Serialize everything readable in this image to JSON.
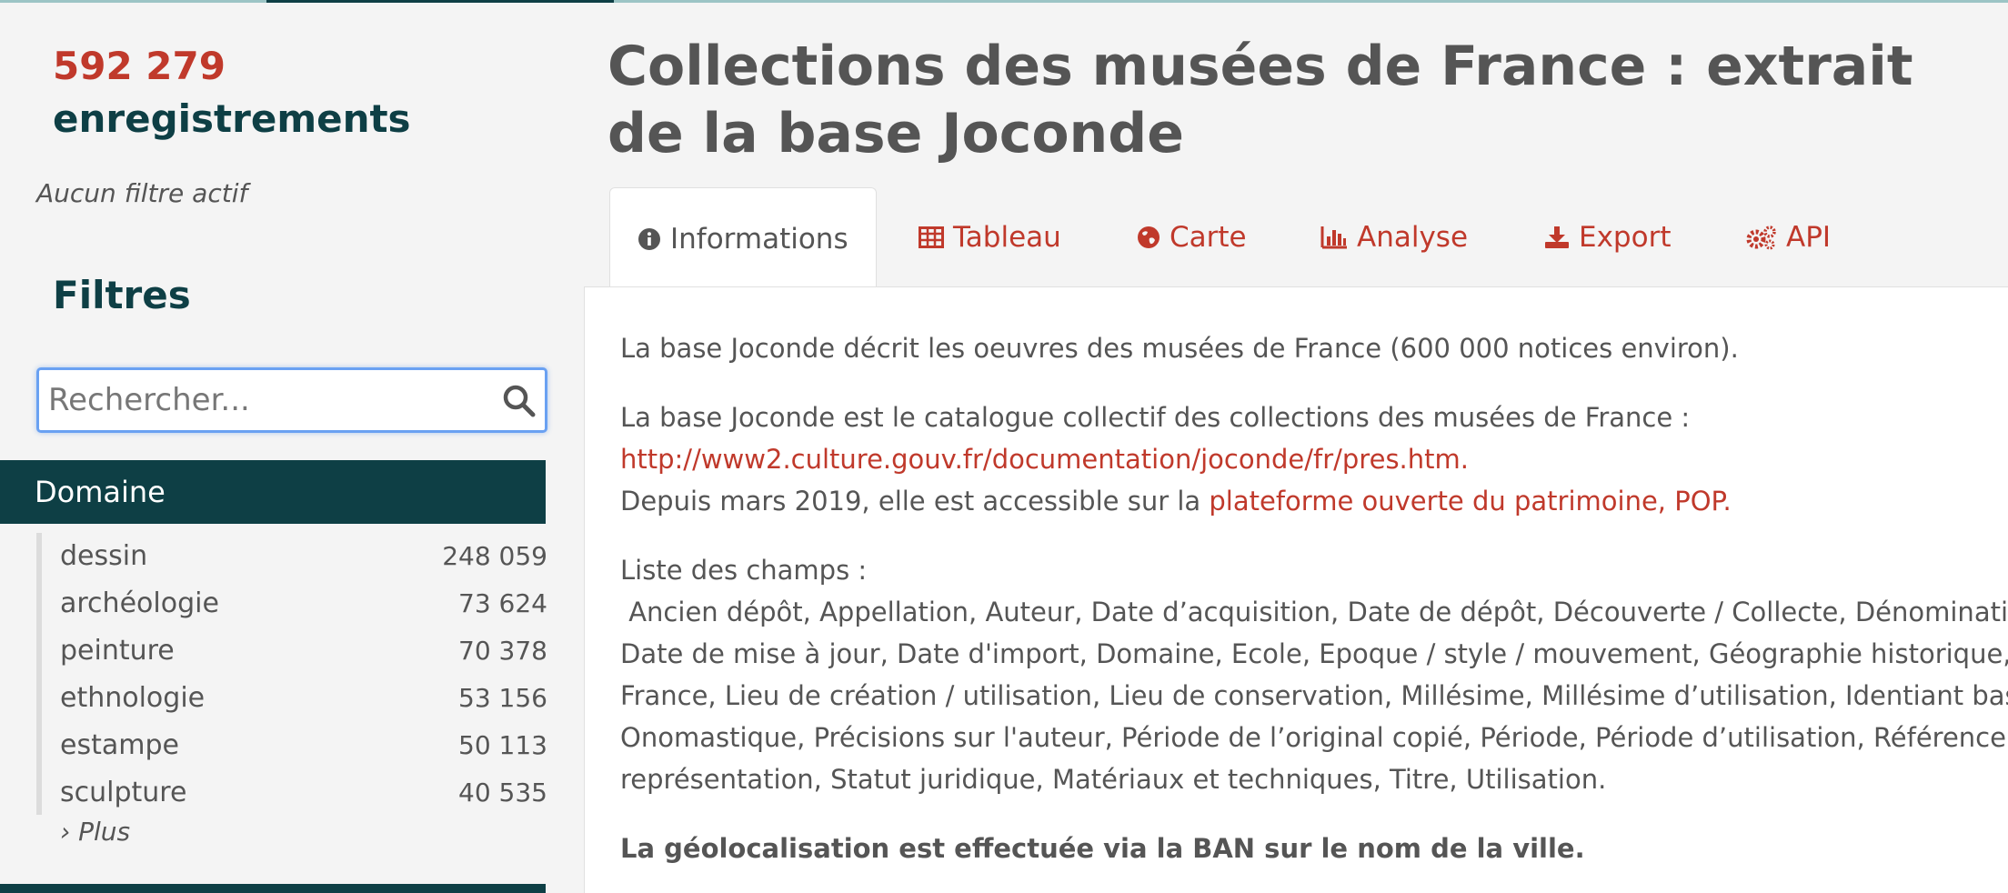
{
  "sidebar": {
    "count_number": "592 279",
    "count_label": "enregistrements",
    "active_filters": "Aucun filtre actif",
    "filters_title": "Filtres",
    "search_placeholder": "Rechercher...",
    "domain_header": "Domaine",
    "domain_items": [
      {
        "label": "dessin",
        "count": "248 059"
      },
      {
        "label": "archéologie",
        "count": "73 624"
      },
      {
        "label": "peinture",
        "count": "70 378"
      },
      {
        "label": "ethnologie",
        "count": "53 156"
      },
      {
        "label": "estampe",
        "count": "50 113"
      },
      {
        "label": "sculpture",
        "count": "40 535"
      }
    ],
    "more_label": "› Plus"
  },
  "main": {
    "title": "Collections des musées de France : extrait de la base Joconde",
    "tabs": [
      {
        "label": "Informations",
        "icon": "info-circle-icon",
        "active": true
      },
      {
        "label": "Tableau",
        "icon": "table-icon",
        "active": false
      },
      {
        "label": "Carte",
        "icon": "globe-icon",
        "active": false
      },
      {
        "label": "Analyse",
        "icon": "bar-chart-icon",
        "active": false
      },
      {
        "label": "Export",
        "icon": "download-icon",
        "active": false
      },
      {
        "label": "API",
        "icon": "gears-icon",
        "active": false
      }
    ],
    "content": {
      "p1": "La base Joconde décrit les oeuvres des musées de France (600 000 notices environ).",
      "p2_line1": "La base Joconde est le catalogue collectif des collections des musées de France :",
      "p2_link": "http://www2.culture.gouv.fr/documentation/joconde/fr/pres.htm.",
      "p2_line3_prefix": "Depuis mars 2019, elle est accessible sur la ",
      "p2_line3_link": "plateforme ouverte du patrimoine,  POP.",
      "p3_heading": "Liste des champs :",
      "p3_lines": [
        " Ancien dépôt, Appellation, Auteur, Date d’acquisition, Date de dépôt, Découverte / Collecte, Dénomination, De",
        "Date de mise à jour, Date d'import, Domaine, Ecole, Epoque / style / mouvement, Géographie historique, Num",
        "France, Lieu de création / utilisation, Lieu de conservation, Millésime, Millésime d’utilisation, Identiant base Mu",
        "Onomastique, Précisions sur l'auteur, Période de l’original copié, Période, Période d’utilisation, Référence, Suje",
        "représentation, Statut juridique, Matériaux et techniques, Titre, Utilisation."
      ],
      "p4": "La géolocalisation est effectuée via la BAN sur le nom de la ville."
    }
  },
  "colors": {
    "accent_red": "#c0392b",
    "dark_teal": "#0e3f45",
    "focus_blue": "#6aa1f2"
  }
}
